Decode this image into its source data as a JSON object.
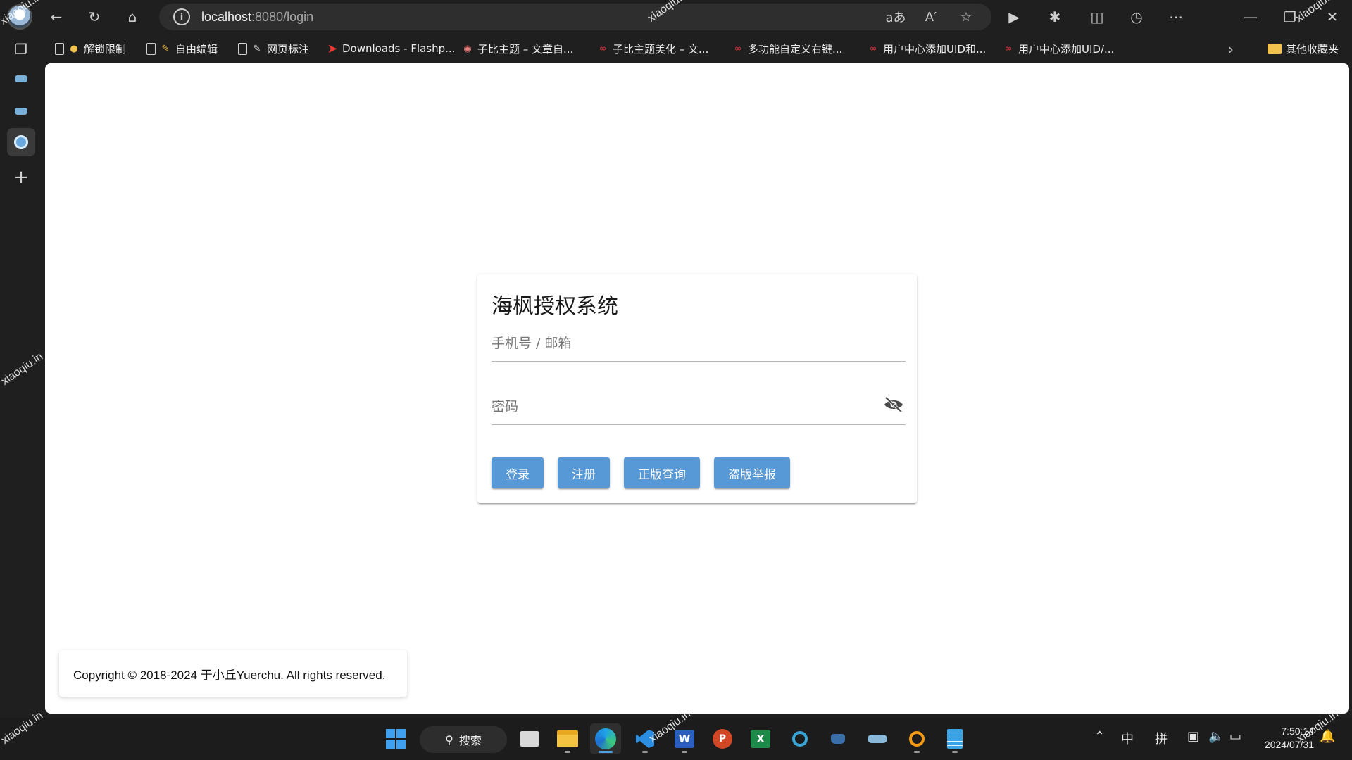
{
  "browser": {
    "url_host": "localhost",
    "url_rest": ":8080/login",
    "bookmarks": [
      {
        "label": "解锁限制",
        "icon": "lock-icon"
      },
      {
        "label": "自由编辑",
        "icon": "edit-icon"
      },
      {
        "label": "网页标注",
        "icon": "pen-icon"
      },
      {
        "label": "Downloads - Flashp...",
        "icon": "flashpoint-icon"
      },
      {
        "label": "子比主题 – 文章自...",
        "icon": "site-icon"
      },
      {
        "label": "子比主题美化 – 文...",
        "icon": "site-icon"
      },
      {
        "label": "多功能自定义右键...",
        "icon": "site-icon"
      },
      {
        "label": "用户中心添加UID和...",
        "icon": "site-icon"
      },
      {
        "label": "用户中心添加UID/...",
        "icon": "site-icon"
      }
    ],
    "other_bookmarks": "其他收藏夹"
  },
  "login": {
    "title": "海枫授权系统",
    "account_placeholder": "手机号 / 邮箱",
    "password_placeholder": "密码",
    "buttons": {
      "login": "登录",
      "register": "注册",
      "verify": "正版查询",
      "report": "盗版举报"
    }
  },
  "footer": {
    "copyright": "Copyright © 2018-2024 于小丘Yuerchu. All rights reserved."
  },
  "taskbar": {
    "search_label": "搜索",
    "ime_lang": "中",
    "ime_mode": "拼",
    "time": "7:50:14",
    "date": "2024/07/31"
  },
  "watermark": "xiaoqiu.in"
}
